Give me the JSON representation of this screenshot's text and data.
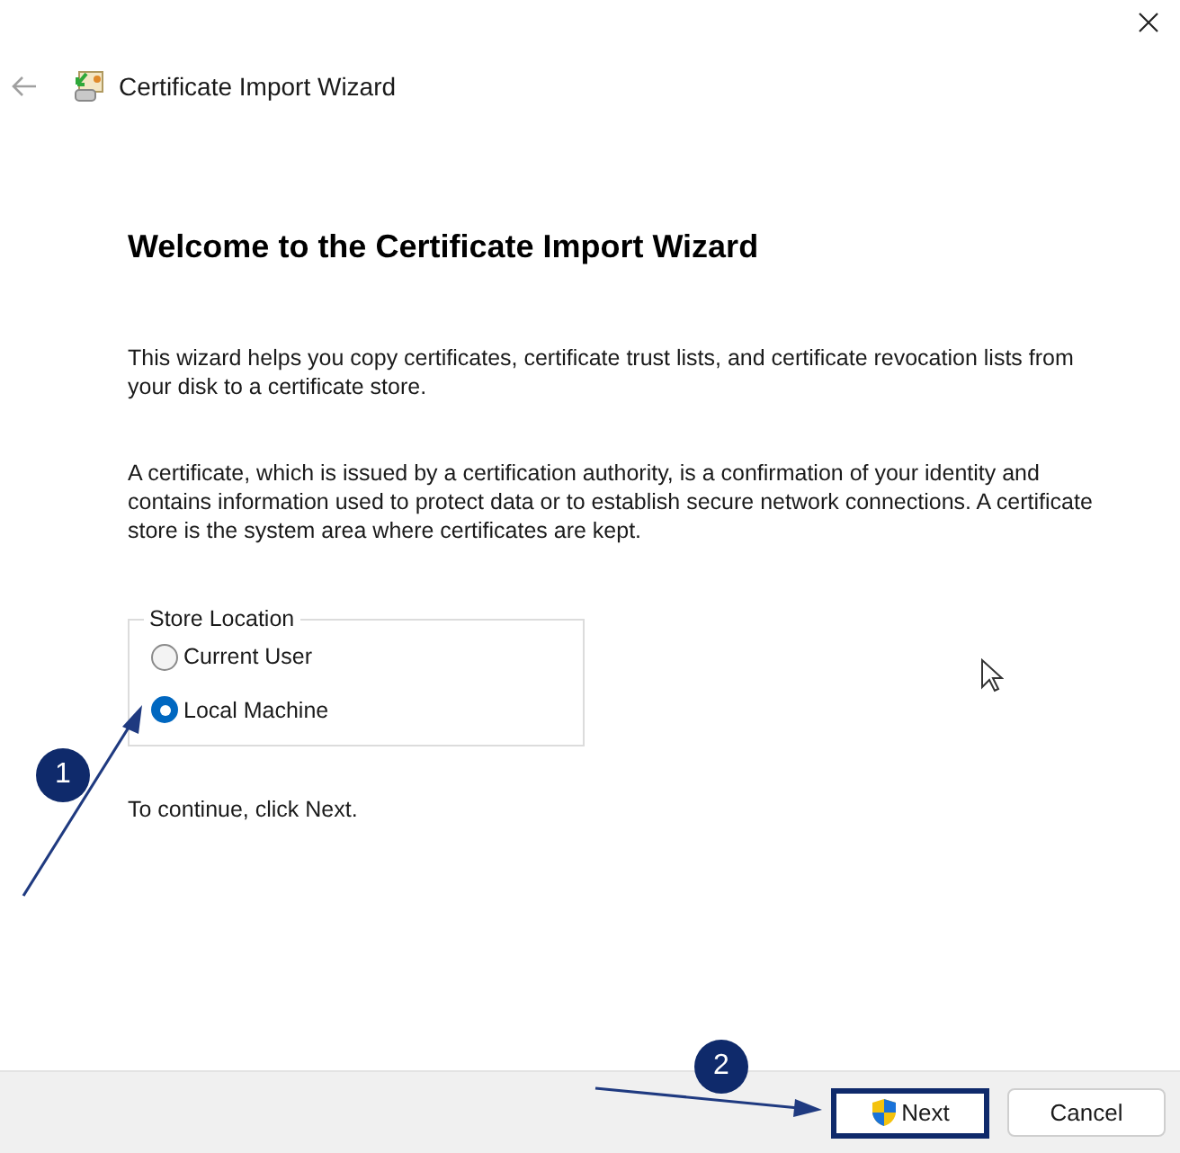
{
  "window": {
    "title": "Certificate Import Wizard"
  },
  "heading": "Welcome to the Certificate Import Wizard",
  "paragraphs": [
    "This wizard helps you copy certificates, certificate trust lists, and certificate revocation lists from your disk to a certificate store.",
    "A certificate, which is issued by a certification authority, is a confirmation of your identity and contains information used to protect data or to establish secure network connections. A certificate store is the system area where certificates are kept."
  ],
  "store_location": {
    "label": "Store Location",
    "options": [
      {
        "label": "Current User",
        "selected": false
      },
      {
        "label": "Local Machine",
        "selected": true
      }
    ]
  },
  "instruction": "To continue, click Next.",
  "buttons": [
    {
      "label": "Next",
      "kind": "primary"
    },
    {
      "label": "Cancel",
      "kind": "normal"
    }
  ],
  "callouts": [
    "1",
    "2"
  ]
}
